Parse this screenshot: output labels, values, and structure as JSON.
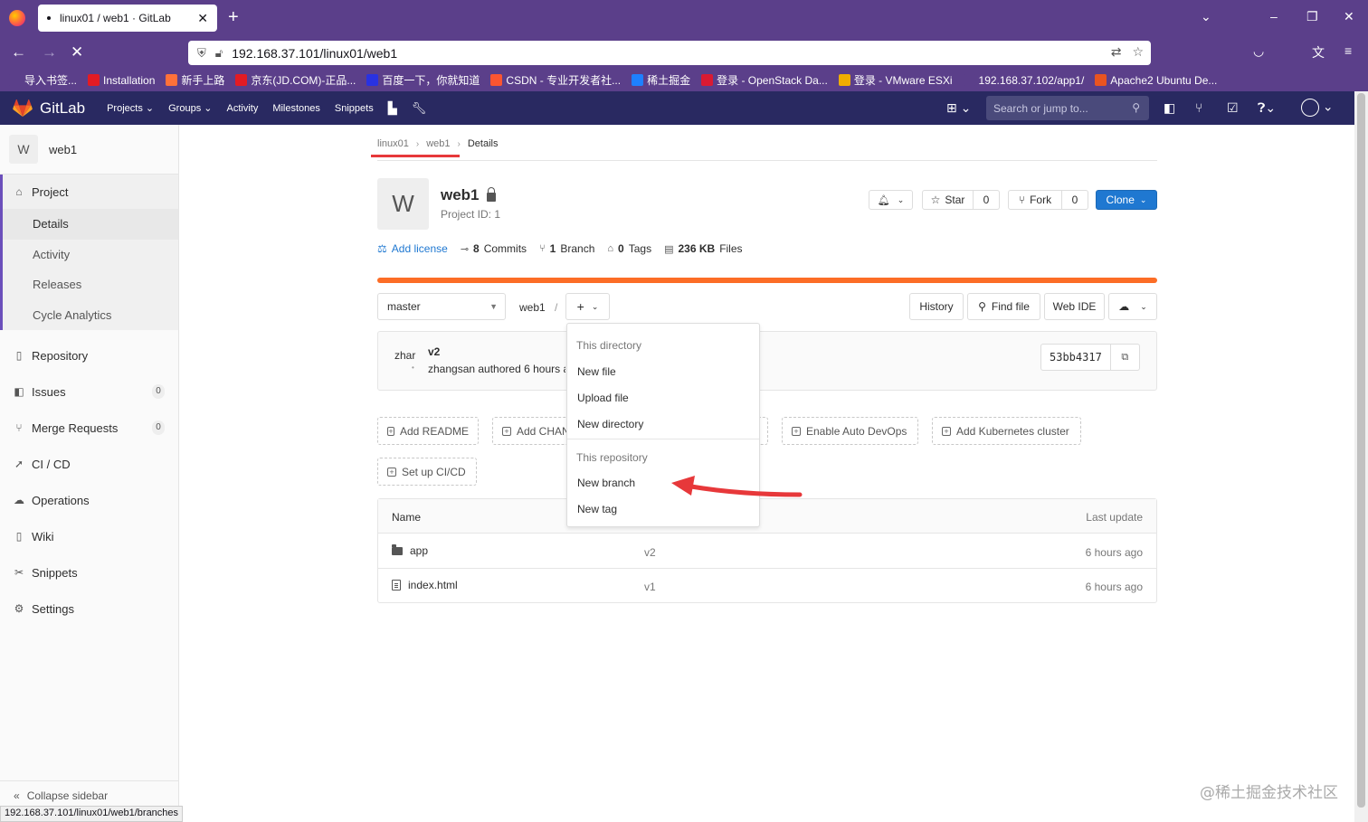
{
  "browser": {
    "tab_title": "linux01 / web1 · GitLab",
    "url": "192.168.37.101/linux01/web1",
    "status_url": "192.168.37.101/linux01/web1/branches",
    "bookmarks": [
      {
        "label": "导入书签...",
        "color": "#5b3f8a"
      },
      {
        "label": "Installation",
        "color": "#e31b23"
      },
      {
        "label": "新手上路",
        "color": "#ff7139"
      },
      {
        "label": "京东(JD.COM)-正品...",
        "color": "#e31b23"
      },
      {
        "label": "百度一下，你就知道",
        "color": "#2932e1"
      },
      {
        "label": "CSDN - 专业开发者社...",
        "color": "#fc5531"
      },
      {
        "label": "稀土掘金",
        "color": "#1e80ff"
      },
      {
        "label": "登录 - OpenStack Da...",
        "color": "#da1a32"
      },
      {
        "label": "登录 - VMware ESXi",
        "color": "#f0ad00"
      },
      {
        "label": "192.168.37.102/app1/",
        "color": "#5b3f8a"
      },
      {
        "label": "Apache2 Ubuntu De...",
        "color": "#e95420"
      }
    ]
  },
  "gitlab": {
    "brand": "GitLab",
    "nav": [
      "Projects",
      "Groups",
      "Activity",
      "Milestones",
      "Snippets"
    ],
    "search_placeholder": "Search or jump to..."
  },
  "sidebar": {
    "avatar_letter": "W",
    "project_name": "web1",
    "project_label": "Project",
    "sub_items": [
      "Details",
      "Activity",
      "Releases",
      "Cycle Analytics"
    ],
    "items": [
      {
        "label": "Repository",
        "icon": "book-icon"
      },
      {
        "label": "Issues",
        "icon": "issues-icon",
        "badge": "0"
      },
      {
        "label": "Merge Requests",
        "icon": "merge-request-icon",
        "badge": "0"
      },
      {
        "label": "CI / CD",
        "icon": "rocket-icon"
      },
      {
        "label": "Operations",
        "icon": "cloud-gear-icon"
      },
      {
        "label": "Wiki",
        "icon": "book-icon"
      },
      {
        "label": "Snippets",
        "icon": "scissors-icon"
      },
      {
        "label": "Settings",
        "icon": "gear-icon"
      }
    ],
    "collapse": "Collapse sidebar"
  },
  "breadcrumb": [
    "linux01",
    "web1",
    "Details"
  ],
  "project": {
    "avatar_letter": "W",
    "title": "web1",
    "id_text": "Project ID: 1",
    "star_label": "Star",
    "star_count": "0",
    "fork_label": "Fork",
    "fork_count": "0",
    "clone_label": "Clone"
  },
  "stats": {
    "add_license": "Add license",
    "commits_num": "8",
    "commits_label": "Commits",
    "branch_num": "1",
    "branch_label": "Branch",
    "tags_num": "0",
    "tags_label": "Tags",
    "files_size": "236 KB",
    "files_label": "Files"
  },
  "toolbar": {
    "branch": "master",
    "path": "web1",
    "slash": "/",
    "history": "History",
    "find_file": "Find file",
    "web_ide": "Web IDE"
  },
  "commit": {
    "author_short": "zhar",
    "title": "v2",
    "meta": "zhangsan authored 6 hours ago",
    "sha": "53bb4317"
  },
  "action_buttons": {
    "readme": "Add README",
    "changelog": "Add CHANGELOG",
    "autodevops": "Enable Auto DevOps",
    "kubernetes": "Add Kubernetes cluster",
    "cicd": "Set up CI/CD"
  },
  "files": {
    "headers": {
      "name": "Name",
      "last_update": "Last update"
    },
    "rows": [
      {
        "name": "app",
        "type": "folder",
        "message": "v2",
        "updated": "6 hours ago"
      },
      {
        "name": "index.html",
        "type": "file",
        "message": "v1",
        "updated": "6 hours ago"
      }
    ]
  },
  "dropdown": {
    "section1": "This directory",
    "new_file": "New file",
    "upload_file": "Upload file",
    "new_directory": "New directory",
    "section2": "This repository",
    "new_branch": "New branch",
    "new_tag": "New tag"
  },
  "watermark": "@稀土掘金技术社区",
  "colors": {
    "browser_chrome": "#5b3f8a",
    "gitlab_header": "#292961",
    "accent_orange": "#fc6d26",
    "link_blue": "#1f78d1",
    "annotation_red": "#e7383a"
  }
}
